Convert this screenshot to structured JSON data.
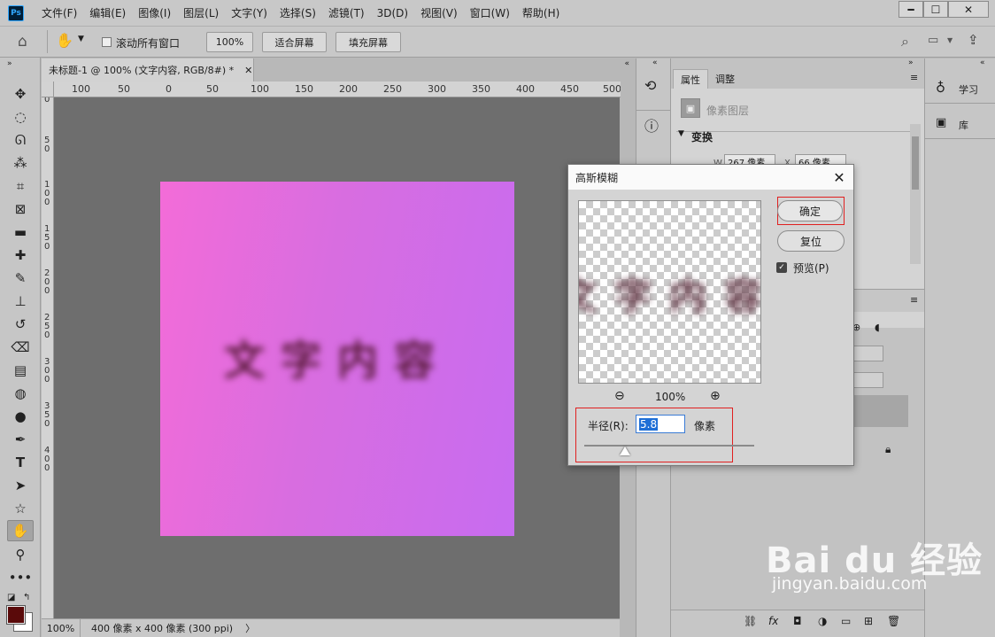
{
  "app": {
    "logo": "Ps"
  },
  "menu": [
    "文件(F)",
    "编辑(E)",
    "图像(I)",
    "图层(L)",
    "文字(Y)",
    "选择(S)",
    "滤镜(T)",
    "3D(D)",
    "视图(V)",
    "窗口(W)",
    "帮助(H)"
  ],
  "options": {
    "scroll_all_label": "滚动所有窗口",
    "zoom_btn": "100%",
    "fit_screen_btn": "适合屏幕",
    "fill_screen_btn": "填充屏幕"
  },
  "document": {
    "tab_title": "未标题-1 @ 100% (文字内容, RGB/8#) *",
    "canvas_text": "文字内容",
    "ruler_top": [
      "100",
      "50",
      "0",
      "50",
      "100",
      "150",
      "200",
      "250",
      "300",
      "350",
      "400",
      "450",
      "500"
    ],
    "ruler_left": [
      "0",
      "5 0",
      "1 0 0",
      "1 5 0",
      "2 0 0",
      "2 5 0",
      "3 0 0",
      "3 5 0",
      "4 0 0"
    ],
    "colors": {
      "gradient_start": "#f36cd8",
      "gradient_end": "#c76cf0",
      "canvas_bg": "#6e6e6e"
    }
  },
  "status": {
    "zoom": "100%",
    "doc_size": "400 像素 x 400 像素 (300 ppi)",
    "arrow": "〉"
  },
  "panels": {
    "properties_tab": "属性",
    "adjust_tab": "调整",
    "pixel_layer": "像素图层",
    "transform": "变换",
    "w_label": "W",
    "w_value": "267 像素",
    "x_label": "X",
    "x_value": "66 像素",
    "learn": "学习",
    "library": "库"
  },
  "dialog": {
    "title": "高斯模糊",
    "ok_button": "确定",
    "reset_button": "复位",
    "preview_label": "预览(P)",
    "preview_checked": true,
    "preview_text": "文字内容",
    "zoom": "100%",
    "radius_label": "半径(R):",
    "radius_value": "5.8",
    "radius_unit": "像素",
    "slider_level": 0.24
  },
  "watermark": {
    "brand": "Bai du 经验",
    "url": "jingyan.baidu.com"
  }
}
